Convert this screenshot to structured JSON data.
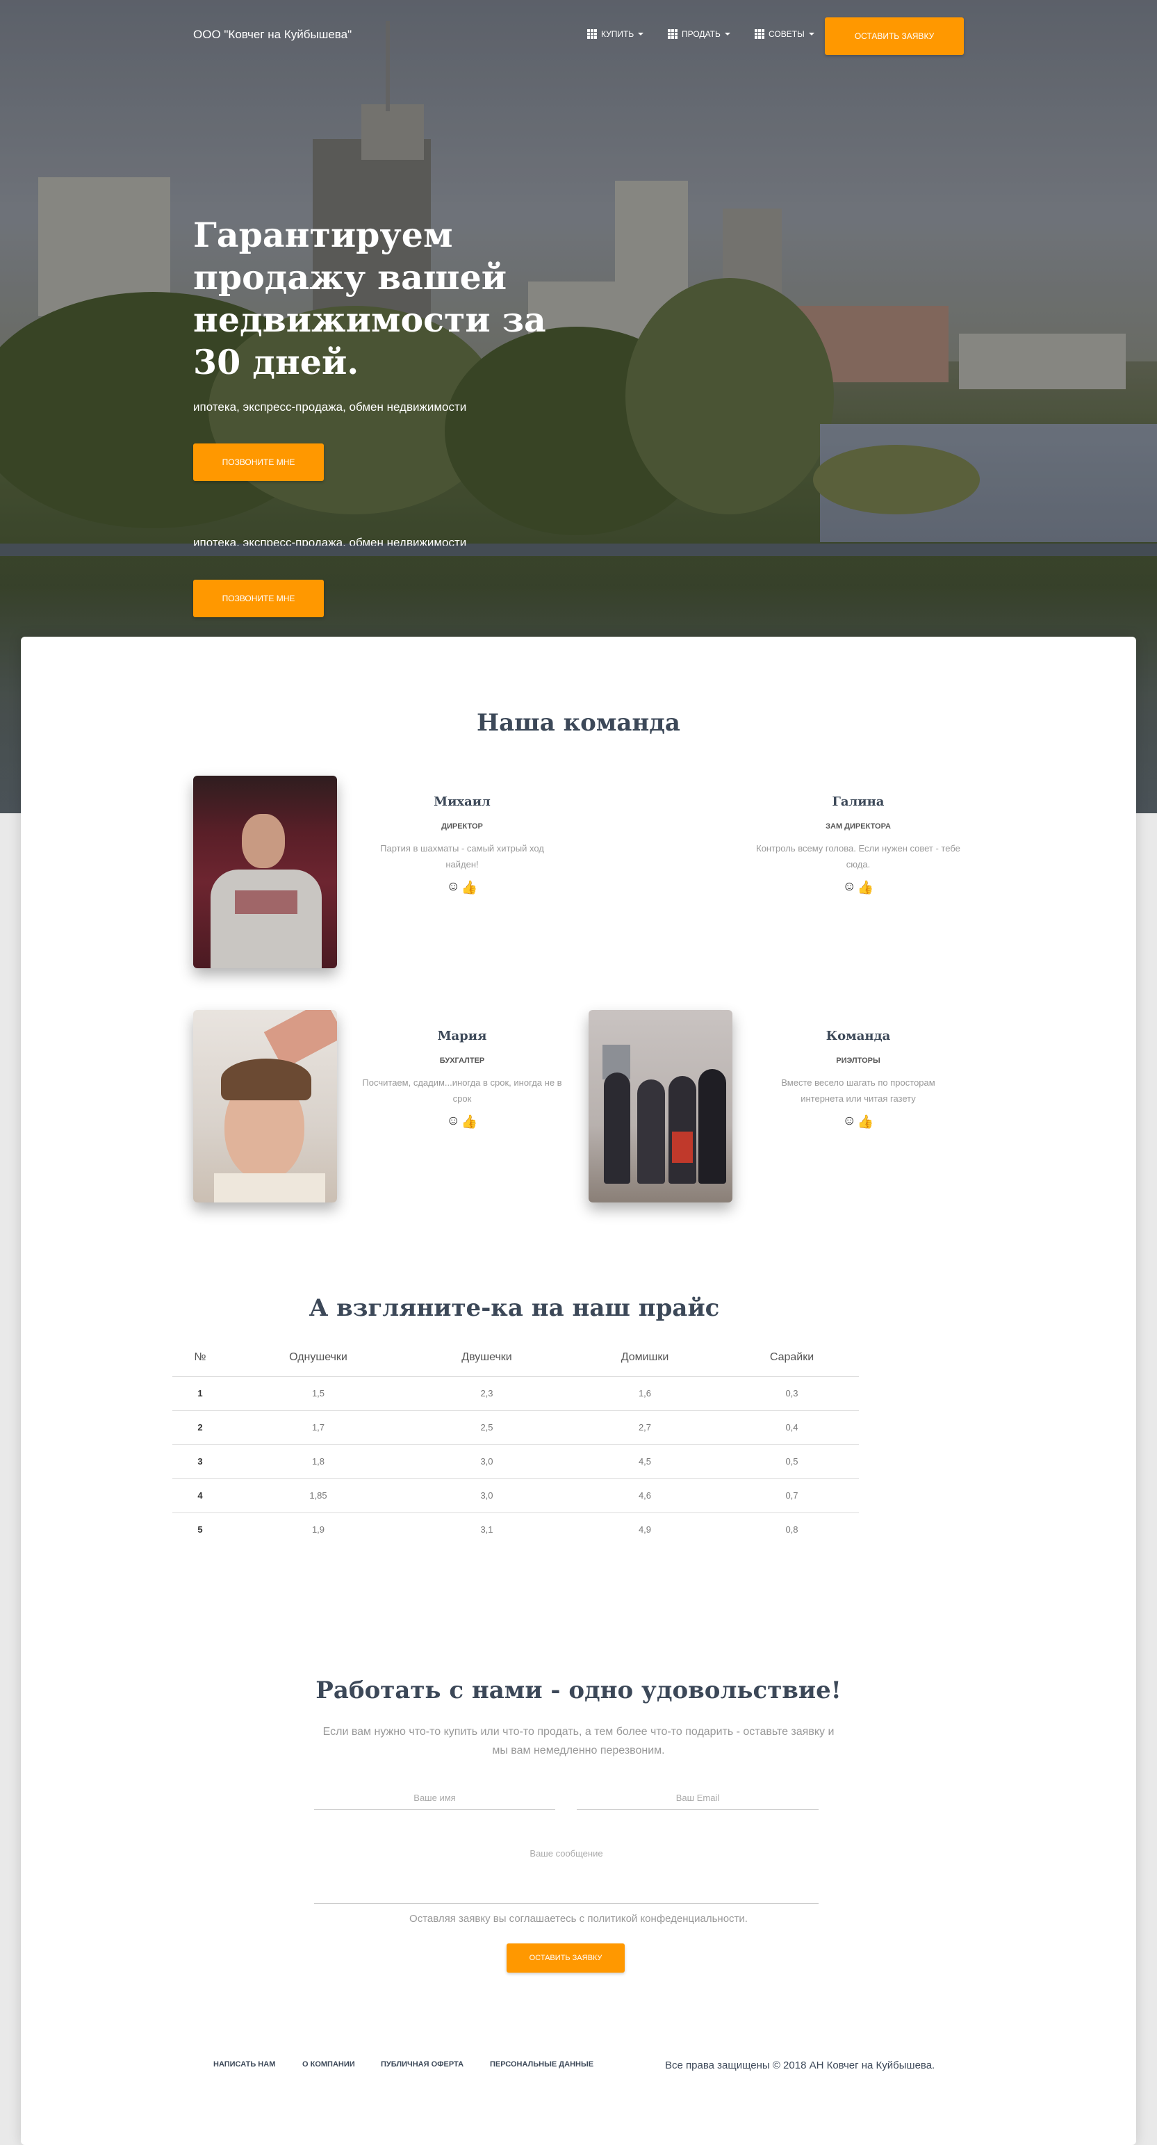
{
  "navbar": {
    "brand": "ООО \"Ковчег на Куйбышева\"",
    "items": [
      {
        "label": "КУПИТЬ"
      },
      {
        "label": "ПРОДАТЬ"
      },
      {
        "label": "СОВЕТЫ"
      }
    ],
    "cta": "ОСТАВИТЬ ЗАЯВКУ"
  },
  "hero": {
    "title": "Гарантируем продажу вашей недвижимости за 30 дней.",
    "subtitle": "ипотека, экспресс-продажа, обмен недвижимости",
    "button": "ПОЗВОНИТЕ МНЕ"
  },
  "team": {
    "title": "Наша команда",
    "members": [
      {
        "name": "Михаил",
        "role": "ДИРЕКТОР",
        "desc": "Партия в шахматы - самый хитрый ход найден!"
      },
      {
        "name": "Галина",
        "role": "ЗАМ ДИРЕКТОРА",
        "desc": "Контроль всему голова. Если нужен совет - тебе сюда."
      },
      {
        "name": "Мария",
        "role": "БУХГАЛТЕР",
        "desc": "Посчитаем, сдадим...иногда в срок, иногда не в срок"
      },
      {
        "name": "Команда",
        "role": "РИЭЛТОРЫ",
        "desc": "Вместе весело шагать по просторам интернета или читая газету"
      }
    ],
    "icons": [
      "smile-icon",
      "thumbs-up-icon"
    ]
  },
  "pricing": {
    "title": "А взгляните-ка на наш прайс",
    "columns": [
      "№",
      "Однушечки",
      "Двушечки",
      "Домишки",
      "Сарайки"
    ],
    "rows": [
      [
        "1",
        "1,5",
        "2,3",
        "1,6",
        "0,3"
      ],
      [
        "2",
        "1,7",
        "2,5",
        "2,7",
        "0,4"
      ],
      [
        "3",
        "1,8",
        "3,0",
        "4,5",
        "0,5"
      ],
      [
        "4",
        "1,85",
        "3,0",
        "4,6",
        "0,7"
      ],
      [
        "5",
        "1,9",
        "3,1",
        "4,9",
        "0,8"
      ]
    ]
  },
  "contact": {
    "title": "Работать с нами - одно удовольствие!",
    "text": "Если вам нужно что-то купить или что-то продать, а тем более что-то подарить - оставьте заявку и мы вам немедленно перезвоним.",
    "name_placeholder": "Ваше имя",
    "email_placeholder": "Ваш Email",
    "message_placeholder": "Ваше сообщение",
    "policy": "Оставляя заявку вы соглашаетесь с политикой конфеденциальности.",
    "submit": "ОСТАВИТЬ ЗАЯВКУ"
  },
  "footer": {
    "links": [
      "НАПИСАТЬ НАМ",
      "О КОМПАНИИ",
      "ПУБЛИЧНАЯ ОФЕРТА",
      "ПЕРСОНАЛЬНЫЕ ДАННЫЕ"
    ],
    "copyright": "Все права защищены © 2018 АН Ковчег на Куйбышева."
  },
  "colors": {
    "accent": "#ff9800",
    "heading": "#3c4858"
  }
}
